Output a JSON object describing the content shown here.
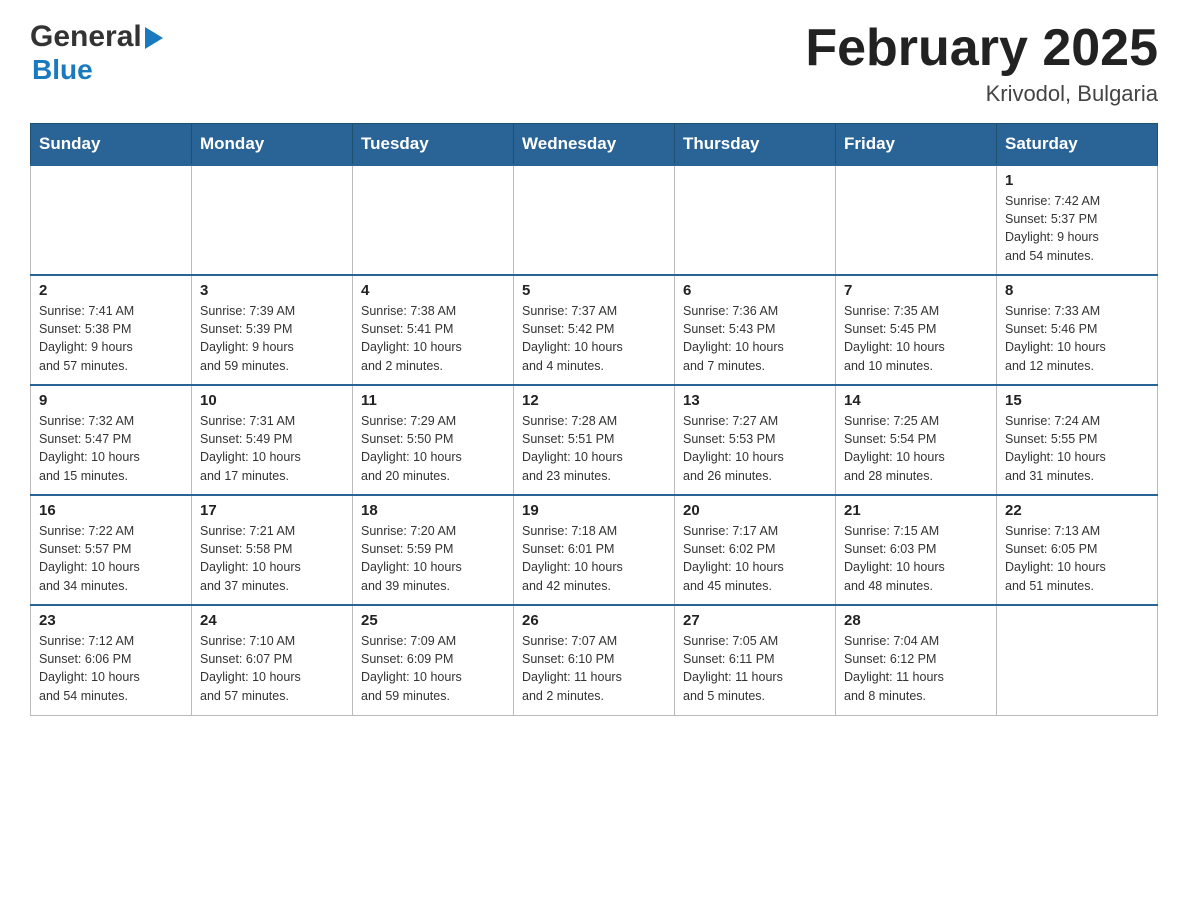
{
  "header": {
    "month_title": "February 2025",
    "location": "Krivodol, Bulgaria",
    "logo_general": "General",
    "logo_blue": "Blue"
  },
  "days_of_week": [
    "Sunday",
    "Monday",
    "Tuesday",
    "Wednesday",
    "Thursday",
    "Friday",
    "Saturday"
  ],
  "weeks": [
    [
      {
        "day": "",
        "info": ""
      },
      {
        "day": "",
        "info": ""
      },
      {
        "day": "",
        "info": ""
      },
      {
        "day": "",
        "info": ""
      },
      {
        "day": "",
        "info": ""
      },
      {
        "day": "",
        "info": ""
      },
      {
        "day": "1",
        "info": "Sunrise: 7:42 AM\nSunset: 5:37 PM\nDaylight: 9 hours\nand 54 minutes."
      }
    ],
    [
      {
        "day": "2",
        "info": "Sunrise: 7:41 AM\nSunset: 5:38 PM\nDaylight: 9 hours\nand 57 minutes."
      },
      {
        "day": "3",
        "info": "Sunrise: 7:39 AM\nSunset: 5:39 PM\nDaylight: 9 hours\nand 59 minutes."
      },
      {
        "day": "4",
        "info": "Sunrise: 7:38 AM\nSunset: 5:41 PM\nDaylight: 10 hours\nand 2 minutes."
      },
      {
        "day": "5",
        "info": "Sunrise: 7:37 AM\nSunset: 5:42 PM\nDaylight: 10 hours\nand 4 minutes."
      },
      {
        "day": "6",
        "info": "Sunrise: 7:36 AM\nSunset: 5:43 PM\nDaylight: 10 hours\nand 7 minutes."
      },
      {
        "day": "7",
        "info": "Sunrise: 7:35 AM\nSunset: 5:45 PM\nDaylight: 10 hours\nand 10 minutes."
      },
      {
        "day": "8",
        "info": "Sunrise: 7:33 AM\nSunset: 5:46 PM\nDaylight: 10 hours\nand 12 minutes."
      }
    ],
    [
      {
        "day": "9",
        "info": "Sunrise: 7:32 AM\nSunset: 5:47 PM\nDaylight: 10 hours\nand 15 minutes."
      },
      {
        "day": "10",
        "info": "Sunrise: 7:31 AM\nSunset: 5:49 PM\nDaylight: 10 hours\nand 17 minutes."
      },
      {
        "day": "11",
        "info": "Sunrise: 7:29 AM\nSunset: 5:50 PM\nDaylight: 10 hours\nand 20 minutes."
      },
      {
        "day": "12",
        "info": "Sunrise: 7:28 AM\nSunset: 5:51 PM\nDaylight: 10 hours\nand 23 minutes."
      },
      {
        "day": "13",
        "info": "Sunrise: 7:27 AM\nSunset: 5:53 PM\nDaylight: 10 hours\nand 26 minutes."
      },
      {
        "day": "14",
        "info": "Sunrise: 7:25 AM\nSunset: 5:54 PM\nDaylight: 10 hours\nand 28 minutes."
      },
      {
        "day": "15",
        "info": "Sunrise: 7:24 AM\nSunset: 5:55 PM\nDaylight: 10 hours\nand 31 minutes."
      }
    ],
    [
      {
        "day": "16",
        "info": "Sunrise: 7:22 AM\nSunset: 5:57 PM\nDaylight: 10 hours\nand 34 minutes."
      },
      {
        "day": "17",
        "info": "Sunrise: 7:21 AM\nSunset: 5:58 PM\nDaylight: 10 hours\nand 37 minutes."
      },
      {
        "day": "18",
        "info": "Sunrise: 7:20 AM\nSunset: 5:59 PM\nDaylight: 10 hours\nand 39 minutes."
      },
      {
        "day": "19",
        "info": "Sunrise: 7:18 AM\nSunset: 6:01 PM\nDaylight: 10 hours\nand 42 minutes."
      },
      {
        "day": "20",
        "info": "Sunrise: 7:17 AM\nSunset: 6:02 PM\nDaylight: 10 hours\nand 45 minutes."
      },
      {
        "day": "21",
        "info": "Sunrise: 7:15 AM\nSunset: 6:03 PM\nDaylight: 10 hours\nand 48 minutes."
      },
      {
        "day": "22",
        "info": "Sunrise: 7:13 AM\nSunset: 6:05 PM\nDaylight: 10 hours\nand 51 minutes."
      }
    ],
    [
      {
        "day": "23",
        "info": "Sunrise: 7:12 AM\nSunset: 6:06 PM\nDaylight: 10 hours\nand 54 minutes."
      },
      {
        "day": "24",
        "info": "Sunrise: 7:10 AM\nSunset: 6:07 PM\nDaylight: 10 hours\nand 57 minutes."
      },
      {
        "day": "25",
        "info": "Sunrise: 7:09 AM\nSunset: 6:09 PM\nDaylight: 10 hours\nand 59 minutes."
      },
      {
        "day": "26",
        "info": "Sunrise: 7:07 AM\nSunset: 6:10 PM\nDaylight: 11 hours\nand 2 minutes."
      },
      {
        "day": "27",
        "info": "Sunrise: 7:05 AM\nSunset: 6:11 PM\nDaylight: 11 hours\nand 5 minutes."
      },
      {
        "day": "28",
        "info": "Sunrise: 7:04 AM\nSunset: 6:12 PM\nDaylight: 11 hours\nand 8 minutes."
      },
      {
        "day": "",
        "info": ""
      }
    ]
  ]
}
